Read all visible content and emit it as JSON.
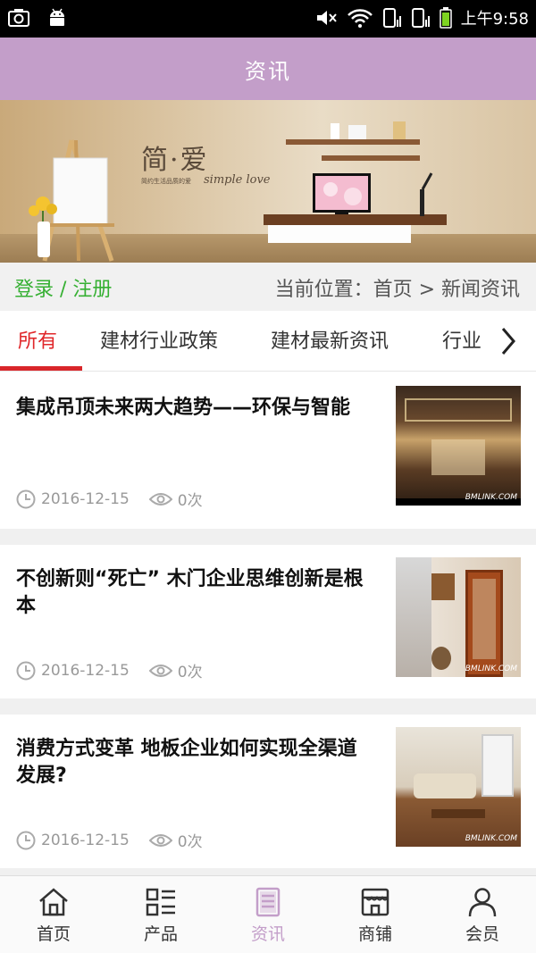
{
  "status_bar": {
    "time": "上午9:58"
  },
  "header": {
    "title": "资讯"
  },
  "banner": {
    "brand_cn": "简·爱",
    "brand_en": "simple love",
    "brand_small": "简约生活品质的爱"
  },
  "location": {
    "login": "登录 / 注册",
    "breadcrumb": "当前位置：首页 > 新闻资讯"
  },
  "tabs": [
    {
      "label": "所有",
      "active": true
    },
    {
      "label": "建材行业政策",
      "active": false
    },
    {
      "label": "建材最新资讯",
      "active": false
    },
    {
      "label": "行业",
      "active": false
    }
  ],
  "articles": [
    {
      "title": "集成吊顶未来两大趋势——环保与智能",
      "date": "2016-12-15",
      "views": "0次",
      "watermark": "BMLINK.COM"
    },
    {
      "title": "不创新则“死亡” 木门企业思维创新是根本",
      "date": "2016-12-15",
      "views": "0次",
      "watermark": "BMLINK.COM"
    },
    {
      "title": "消费方式变革 地板企业如何实现全渠道发展?",
      "date": "2016-12-15",
      "views": "0次",
      "watermark": "BMLINK.COM"
    }
  ],
  "bottom_nav": [
    {
      "label": "首页",
      "icon": "home-icon",
      "active": false
    },
    {
      "label": "产品",
      "icon": "grid-list-icon",
      "active": false
    },
    {
      "label": "资讯",
      "icon": "document-icon",
      "active": true
    },
    {
      "label": "商铺",
      "icon": "store-icon",
      "active": false
    },
    {
      "label": "会员",
      "icon": "user-icon",
      "active": false
    }
  ],
  "colors": {
    "header": "#c39ec9",
    "accent_red": "#e0272a",
    "login_green": "#36b033",
    "nav_active": "#c39ec9"
  }
}
